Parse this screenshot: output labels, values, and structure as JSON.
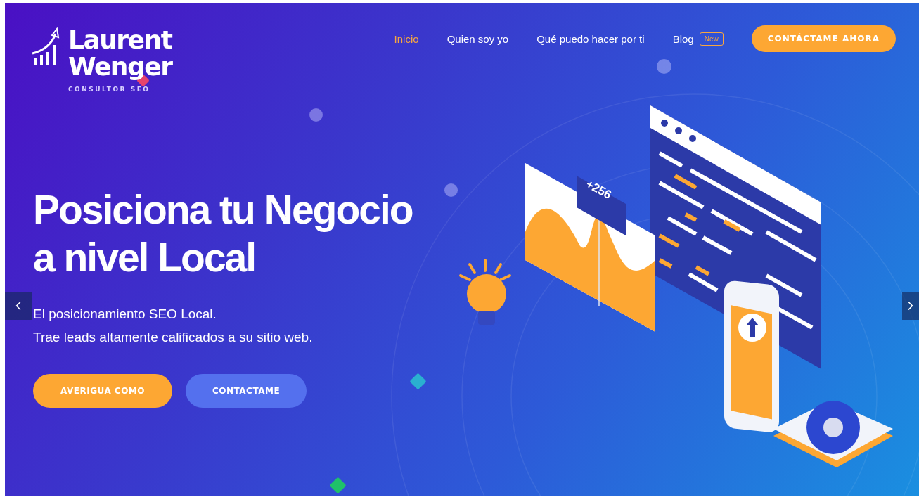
{
  "logo": {
    "line_1": "Laurent",
    "line_2": "Wenger",
    "tagline": "CONSULTOR SEO"
  },
  "nav": [
    {
      "label": "Inicio",
      "selected": true
    },
    {
      "label": "Quien soy yo",
      "selected": false
    },
    {
      "label": "Qué puedo hacer por ti",
      "selected": false
    },
    {
      "label": "Blog",
      "selected": false,
      "badge": "New"
    }
  ],
  "cta": "CONTÁCTAME AHORA",
  "hero": {
    "title_lines": [
      "Posiciona tu Negocio",
      "a nivel Local"
    ],
    "subtitle_lines": [
      "El posicionamiento SEO Local.",
      "Trae leads altamente calificados a su sitio web."
    ],
    "buttons": [
      {
        "label": "AVERIGUA COMO",
        "kind": "primary"
      },
      {
        "label": "CONTACTAME",
        "kind": "secondary"
      }
    ]
  },
  "illustration": {
    "chart_badge": "+256"
  }
}
